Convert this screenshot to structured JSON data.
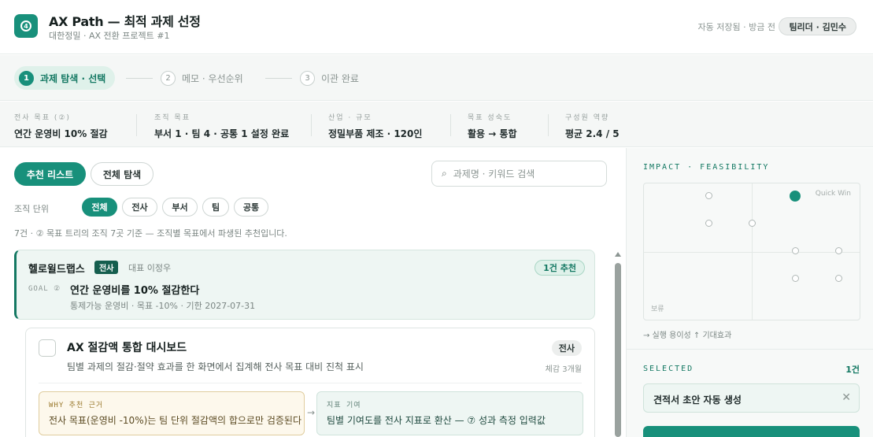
{
  "header": {
    "title": "AX Path — 최적 과제 선정",
    "subtitle": "대한정밀 · AX 전환 프로젝트 #1",
    "save_status": "자동 저장됨 · 방금 전",
    "user": "팀리더 · 김민수"
  },
  "stepper": {
    "steps": [
      {
        "num": "1",
        "label": "과제 탐색 · 선택",
        "active": true
      },
      {
        "num": "2",
        "label": "메모 · 우선순위",
        "active": false
      },
      {
        "num": "3",
        "label": "이관 완료",
        "active": false
      }
    ]
  },
  "context": [
    {
      "label": "전사 목표 (②)",
      "value": "연간 운영비 10% 절감"
    },
    {
      "label": "조직 목표",
      "value": "부서 1 · 팀 4 · 공통 1 설정 완료"
    },
    {
      "label": "산업 · 규모",
      "value": "정밀부품 제조 · 120인"
    },
    {
      "label": "목표 성숙도",
      "value": "활용 → 통합"
    },
    {
      "label": "구성원 역량",
      "value": "평균 2.4 / 5"
    }
  ],
  "toolbar": {
    "tab_recommended": "추천 리스트",
    "tab_all": "전체 탐색",
    "search_placeholder": "과제명 · 키워드 검색"
  },
  "filter": {
    "label": "조직 단위",
    "chips": [
      "전체",
      "전사",
      "부서",
      "팀",
      "공통"
    ],
    "active": "전체"
  },
  "info_line": "7건 · ② 목표 트리의 조직 7곳 기준 — 조직별 목표에서 파생된 추천입니다.",
  "org_card": {
    "name": "헬로윌드랩스",
    "badge": "전사",
    "rep": "대표 이정우",
    "rec_count": "1건 추천",
    "goal_label": "GOAL ②",
    "goal_title": "연간 운영비를 10% 절감한다",
    "goal_meta": "통제가능 운영비 · 목표 -10% · 기한 2027-07-31"
  },
  "task_card": {
    "title": "AX 절감액 통합 대시보드",
    "desc": "팀별 과제의 절감·절약 효과를 한 화면에서 집계해 전사 목표 대비 진척 표시",
    "scope": "전사",
    "duration": "체감 3개월",
    "why_label": "WHY 추천 근거",
    "why_text": "전사 목표(운영비 -10%)는 팀 단위 절감액의 합으로만 검증된다",
    "contrib_label": "지표 기여",
    "contrib_text": "팀별 기여도를 전사 지표로 환산 — ⑦ 성과 측정 입력값"
  },
  "right_panel": {
    "matrix_label": "IMPACT · FEASIBILITY",
    "quick_win": "Quick Win",
    "hold": "보류",
    "axis_note": "→ 실행 용이성   ↑ 기대효과",
    "selected_label": "SELECTED",
    "selected_count": "1건",
    "selected_items": [
      "견적서 초안 자동 생성"
    ]
  },
  "colors": {
    "accent": "#18907b",
    "accent_dark": "#137862",
    "why_bg": "#fdf8ec",
    "contrib_bg": "#eef6f3"
  }
}
